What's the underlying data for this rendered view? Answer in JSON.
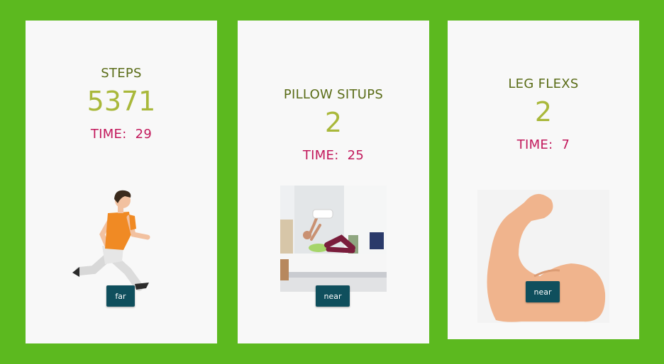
{
  "cards": [
    {
      "title": "STEPS",
      "count": "5371",
      "time_label": "TIME:",
      "time_value": "29",
      "button": "far",
      "image": "running-man-icon"
    },
    {
      "title": "PILLOW SITUPS",
      "count": "2",
      "time_label": "TIME:",
      "time_value": "25",
      "button": "near",
      "image": "pillow-situps-photo"
    },
    {
      "title": "LEG FLEXS",
      "count": "2",
      "time_label": "TIME:",
      "time_value": "7",
      "button": "near",
      "image": "flexed-arm-icon"
    }
  ],
  "colors": {
    "background": "#5cb91f",
    "card": "#f8f8f8",
    "title": "#5a6c17",
    "count": "#a9b83a",
    "time": "#c2185b",
    "button": "#0f4f5d"
  }
}
